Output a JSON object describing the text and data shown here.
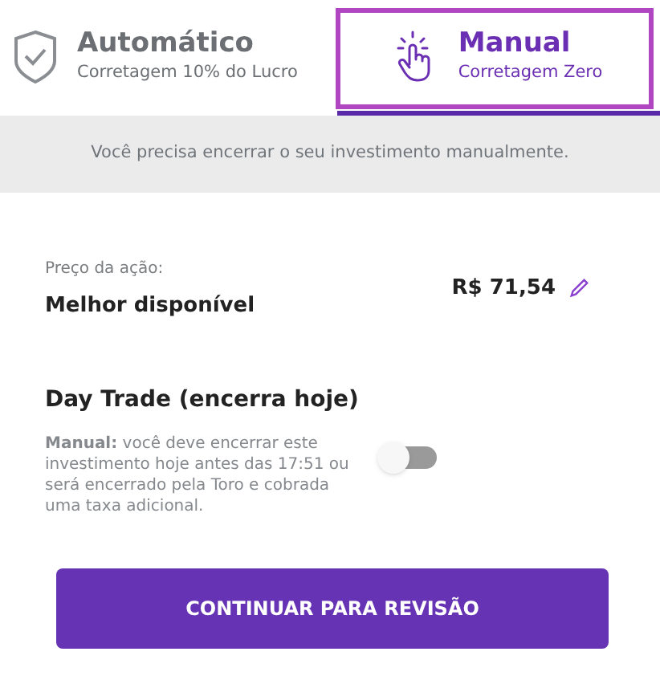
{
  "tabs": [
    {
      "kind": "shield",
      "title": "Automático",
      "subtitle": "Corretagem 10% do Lucro",
      "selected": false
    },
    {
      "kind": "tap",
      "title": "Manual",
      "subtitle": "Corretagem Zero",
      "selected": true
    }
  ],
  "notice": "Você precisa encerrar o seu investimento manualmente.",
  "price": {
    "label": "Preço da ação:",
    "value": "Melhor disponível",
    "amount": "R$ 71,54"
  },
  "day_trade": {
    "title": "Day Trade (encerra hoje)",
    "description": "**Manual:** você deve encerrar este investimento hoje antes das 17:51 ou será encerrado pela Toro e cobrada uma taxa adicional.",
    "on": false
  },
  "button": "CONTINUAR PARA REVISÃO"
}
